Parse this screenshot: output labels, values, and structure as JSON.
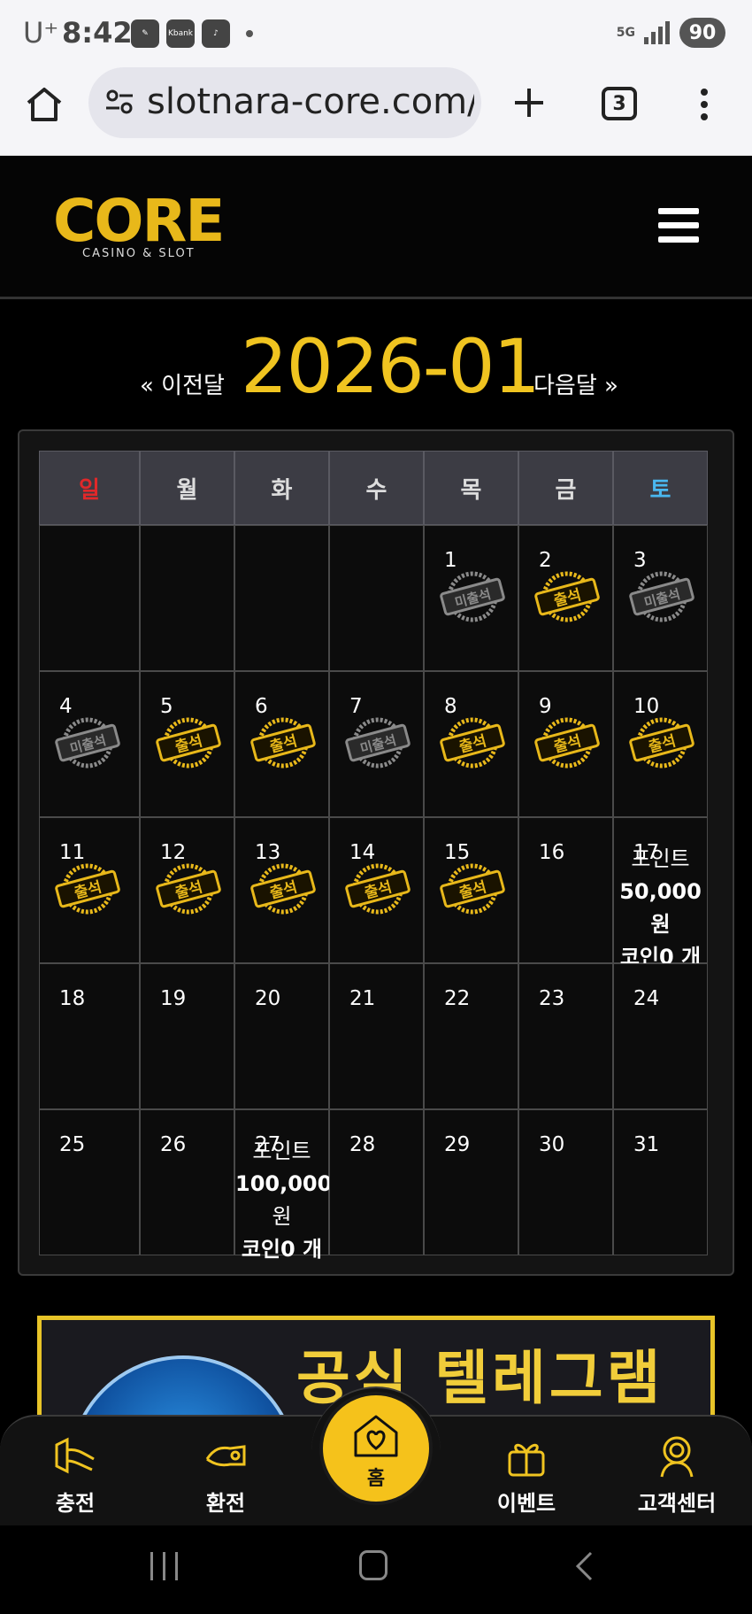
{
  "status_bar": {
    "carrier": "U⁺",
    "time": "8:42",
    "apps": [
      "Kbank",
      "tiktok-icon",
      "pen-icon"
    ],
    "network": "5G",
    "battery": "90"
  },
  "browser": {
    "url": "slotnara-core.com/",
    "tab_count": "3"
  },
  "site": {
    "logo_text": "CORE",
    "logo_sub": "CASINO & SLOT",
    "accent_color": "#f0c420"
  },
  "calendar": {
    "prev_label": "« 이전달",
    "next_label": "다음달 »",
    "month": "2026-01",
    "weekdays": [
      "일",
      "월",
      "화",
      "수",
      "목",
      "금",
      "토"
    ],
    "stamp_attended": "출석",
    "stamp_absent": "미출석",
    "weeks": [
      [
        {
          "day": "",
          "stamp": ""
        },
        {
          "day": "",
          "stamp": ""
        },
        {
          "day": "",
          "stamp": ""
        },
        {
          "day": "",
          "stamp": ""
        },
        {
          "day": "1",
          "stamp": "absent"
        },
        {
          "day": "2",
          "stamp": "attended"
        },
        {
          "day": "3",
          "stamp": "absent"
        }
      ],
      [
        {
          "day": "4",
          "stamp": "absent"
        },
        {
          "day": "5",
          "stamp": "attended"
        },
        {
          "day": "6",
          "stamp": "attended"
        },
        {
          "day": "7",
          "stamp": "absent"
        },
        {
          "day": "8",
          "stamp": "attended"
        },
        {
          "day": "9",
          "stamp": "attended"
        },
        {
          "day": "10",
          "stamp": "attended"
        }
      ],
      [
        {
          "day": "11",
          "stamp": "attended"
        },
        {
          "day": "12",
          "stamp": "attended"
        },
        {
          "day": "13",
          "stamp": "attended"
        },
        {
          "day": "14",
          "stamp": "attended"
        },
        {
          "day": "15",
          "stamp": "attended"
        },
        {
          "day": "16",
          "stamp": ""
        },
        {
          "day": "17",
          "stamp": "",
          "info": [
            "포인트",
            "50,000 원",
            "코인0 개"
          ]
        }
      ],
      [
        {
          "day": "18",
          "stamp": ""
        },
        {
          "day": "19",
          "stamp": ""
        },
        {
          "day": "20",
          "stamp": ""
        },
        {
          "day": "21",
          "stamp": ""
        },
        {
          "day": "22",
          "stamp": ""
        },
        {
          "day": "23",
          "stamp": ""
        },
        {
          "day": "24",
          "stamp": ""
        }
      ],
      [
        {
          "day": "25",
          "stamp": ""
        },
        {
          "day": "26",
          "stamp": ""
        },
        {
          "day": "27",
          "stamp": "",
          "info": [
            "포인트",
            "100,000",
            "원",
            "코인0 개"
          ]
        },
        {
          "day": "28",
          "stamp": ""
        },
        {
          "day": "29",
          "stamp": ""
        },
        {
          "day": "30",
          "stamp": ""
        },
        {
          "day": "31",
          "stamp": ""
        }
      ]
    ]
  },
  "banner": {
    "text": "공식 텔레그램"
  },
  "bottom_nav": {
    "items": [
      {
        "label": "충전",
        "icon": "deposit-icon"
      },
      {
        "label": "환전",
        "icon": "withdraw-icon"
      },
      {
        "label": "홈",
        "icon": "home-heart-icon"
      },
      {
        "label": "이벤트",
        "icon": "gift-icon"
      },
      {
        "label": "고객센터",
        "icon": "support-icon"
      }
    ]
  }
}
